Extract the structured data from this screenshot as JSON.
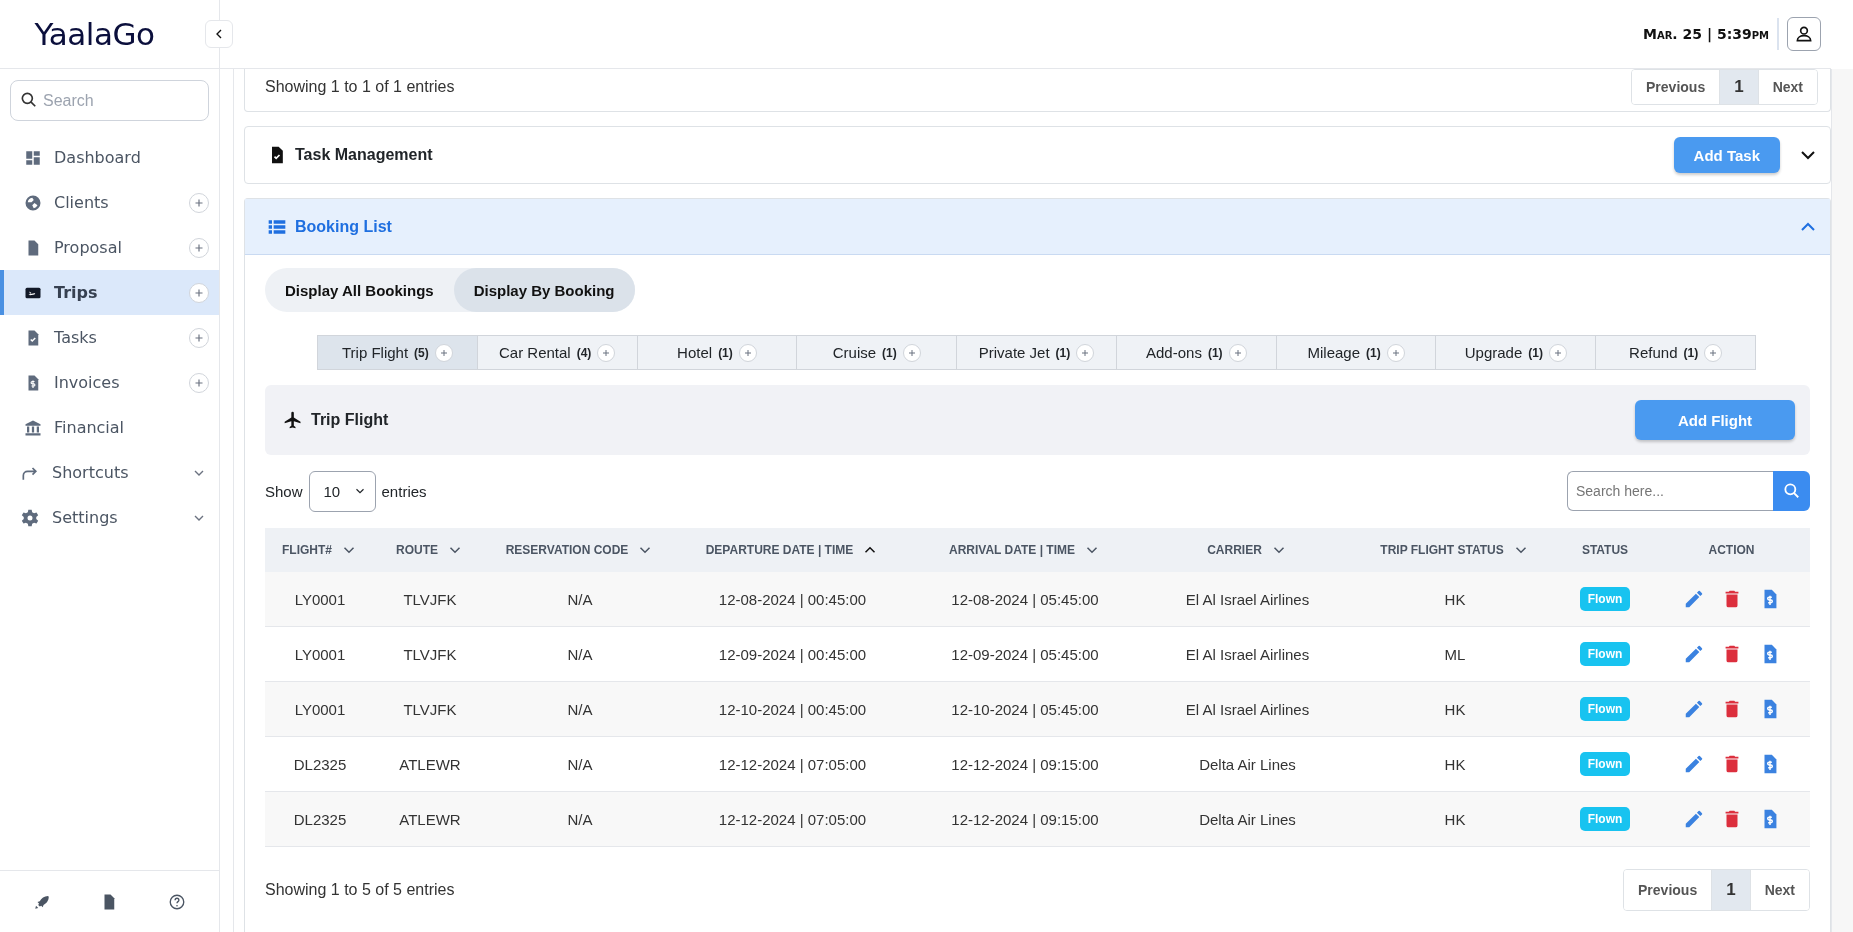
{
  "app": {
    "logo": "YaalaGo"
  },
  "sidebar": {
    "search": {
      "placeholder": "Search"
    },
    "items": [
      {
        "label": "Dashboard",
        "kind": "plain",
        "selected": false
      },
      {
        "label": "Clients",
        "kind": "add",
        "selected": false
      },
      {
        "label": "Proposal",
        "kind": "add",
        "selected": false
      },
      {
        "label": "Trips",
        "kind": "add",
        "selected": true
      },
      {
        "label": "Tasks",
        "kind": "add",
        "selected": false
      },
      {
        "label": "Invoices",
        "kind": "add",
        "selected": false
      },
      {
        "label": "Financial",
        "kind": "plain",
        "selected": false
      },
      {
        "label": "Shortcuts",
        "kind": "expand",
        "selected": false
      },
      {
        "label": "Settings",
        "kind": "expand",
        "selected": false
      }
    ]
  },
  "header": {
    "datetime": "Mar. 25 | 5:39pm"
  },
  "previous_card": {
    "info": "Showing 1 to 1 of 1 entries",
    "pagination": [
      {
        "label": "Previous",
        "selected": false
      },
      {
        "label": "1",
        "selected": true
      },
      {
        "label": "Next",
        "selected": false
      }
    ]
  },
  "task_management": {
    "title": "Task Management",
    "button": "Add Task",
    "expanded": false
  },
  "booking_list": {
    "title": "Booking List",
    "expanded": true,
    "views": [
      {
        "label": "Display All Bookings",
        "selected": false
      },
      {
        "label": "Display By Booking",
        "selected": true
      }
    ],
    "tabs": [
      {
        "label": "Trip Flight",
        "count": "(5)",
        "selected": true
      },
      {
        "label": "Car Rental",
        "count": "(4)",
        "selected": false
      },
      {
        "label": "Hotel",
        "count": "(1)",
        "selected": false
      },
      {
        "label": "Cruise",
        "count": "(1)",
        "selected": false
      },
      {
        "label": "Private Jet",
        "count": "(1)",
        "selected": false
      },
      {
        "label": "Add-ons",
        "count": "(1)",
        "selected": false
      },
      {
        "label": "Mileage",
        "count": "(1)",
        "selected": false
      },
      {
        "label": "Upgrade",
        "count": "(1)",
        "selected": false
      },
      {
        "label": "Refund",
        "count": "(1)",
        "selected": false
      }
    ],
    "section": {
      "title": "Trip Flight",
      "button": "Add Flight"
    },
    "length": {
      "prefix": "Show",
      "value": "10",
      "suffix": "entries"
    },
    "search": {
      "placeholder": "Search here..."
    },
    "table": {
      "columns": [
        {
          "label": "FLIGHT#",
          "kind": "text",
          "sorted": false
        },
        {
          "label": "ROUTE",
          "kind": "text",
          "sorted": false
        },
        {
          "label": "RESERVATION CODE",
          "kind": "text",
          "sorted": false
        },
        {
          "label": "DEPARTURE DATE | TIME",
          "kind": "text",
          "sorted": true
        },
        {
          "label": "ARRIVAL DATE | TIME",
          "kind": "text",
          "sorted": false
        },
        {
          "label": "CARRIER",
          "kind": "text",
          "sorted": false
        },
        {
          "label": "TRIP FLIGHT STATUS",
          "kind": "text",
          "sorted": false
        },
        {
          "label": "STATUS",
          "kind": "badge"
        },
        {
          "label": "ACTION",
          "kind": "actions"
        }
      ],
      "rows": [
        {
          "cells": [
            "LY0001",
            "TLVJFK",
            "N/A",
            "12-08-2024 | 00:45:00",
            "12-08-2024 | 05:45:00",
            "El Al Israel Airlines",
            "HK",
            "Flown"
          ]
        },
        {
          "cells": [
            "LY0001",
            "TLVJFK",
            "N/A",
            "12-09-2024 | 00:45:00",
            "12-09-2024 | 05:45:00",
            "El Al Israel Airlines",
            "ML",
            "Flown"
          ]
        },
        {
          "cells": [
            "LY0001",
            "TLVJFK",
            "N/A",
            "12-10-2024 | 00:45:00",
            "12-10-2024 | 05:45:00",
            "El Al Israel Airlines",
            "HK",
            "Flown"
          ]
        },
        {
          "cells": [
            "DL2325",
            "ATLEWR",
            "N/A",
            "12-12-2024 | 07:05:00",
            "12-12-2024 | 09:15:00",
            "Delta Air Lines",
            "HK",
            "Flown"
          ]
        },
        {
          "cells": [
            "DL2325",
            "ATLEWR",
            "N/A",
            "12-12-2024 | 07:05:00",
            "12-12-2024 | 09:15:00",
            "Delta Air Lines",
            "HK",
            "Flown"
          ]
        }
      ]
    },
    "info": "Showing 1 to 5 of 5 entries",
    "pagination": [
      {
        "label": "Previous",
        "selected": false
      },
      {
        "label": "1",
        "selected": true
      },
      {
        "label": "Next",
        "selected": false
      }
    ]
  }
}
